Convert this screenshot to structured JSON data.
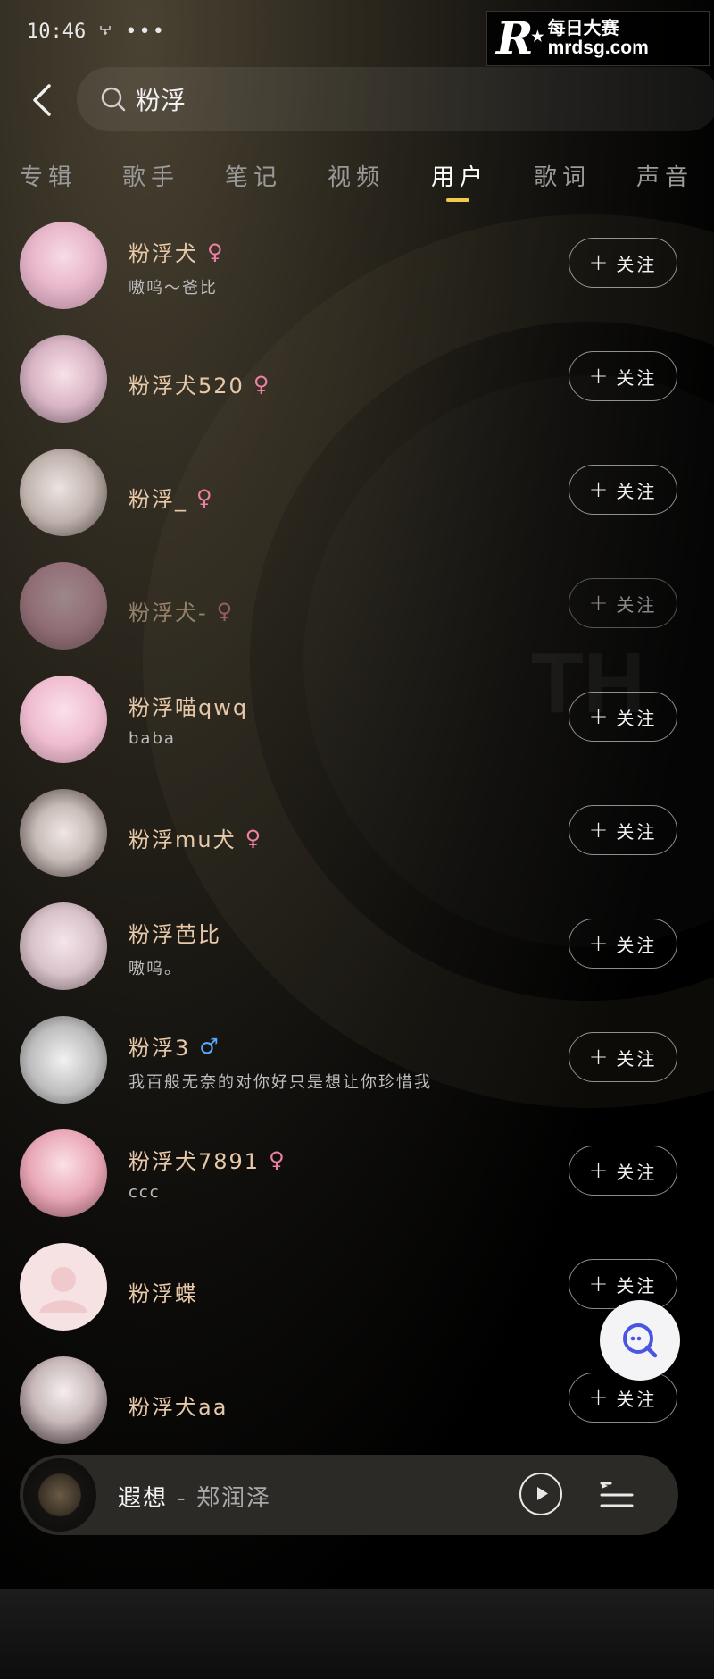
{
  "status_bar": {
    "time": "10:46",
    "extra_icon": "usb-icon",
    "more": "•••"
  },
  "watermark": {
    "mark": "R",
    "text_cn": "每日大赛",
    "url": "mrdsg.com"
  },
  "search": {
    "query": "粉浮"
  },
  "tabs": [
    {
      "label": "专辑",
      "active": false
    },
    {
      "label": "歌手",
      "active": false
    },
    {
      "label": "笔记",
      "active": false
    },
    {
      "label": "视频",
      "active": false
    },
    {
      "label": "用户",
      "active": true
    },
    {
      "label": "歌词",
      "active": false
    },
    {
      "label": "声音",
      "active": false
    }
  ],
  "follow_label": "关注",
  "users": [
    {
      "name": "粉浮犬",
      "gender": "♀",
      "signature": "嗷呜～爸比"
    },
    {
      "name": "粉浮犬520",
      "gender": "♀",
      "signature": ""
    },
    {
      "name": "粉浮_",
      "gender": "♀",
      "signature": ""
    },
    {
      "name": "粉浮犬-",
      "gender": "♀",
      "signature": ""
    },
    {
      "name": "粉浮喵qwq",
      "gender": "",
      "signature": "baba"
    },
    {
      "name": "粉浮mu犬",
      "gender": "♀",
      "signature": ""
    },
    {
      "name": "粉浮芭比",
      "gender": "",
      "signature": "嗷呜。"
    },
    {
      "name": "粉浮3",
      "gender": "♂",
      "signature": "我百般无奈的对你好只是想让你珍惜我"
    },
    {
      "name": "粉浮犬7891",
      "gender": "♀",
      "signature": "ccc"
    },
    {
      "name": "粉浮蝶",
      "gender": "",
      "signature": ""
    },
    {
      "name": "粉浮犬aa",
      "gender": "",
      "signature": ""
    }
  ],
  "player": {
    "song": "遐想",
    "separator": " - ",
    "artist": "郑润泽"
  },
  "colors": {
    "accent": "#f2c94c",
    "username": "#e7c8a8",
    "female": "#ef7fa4",
    "male": "#5aa8ff"
  }
}
